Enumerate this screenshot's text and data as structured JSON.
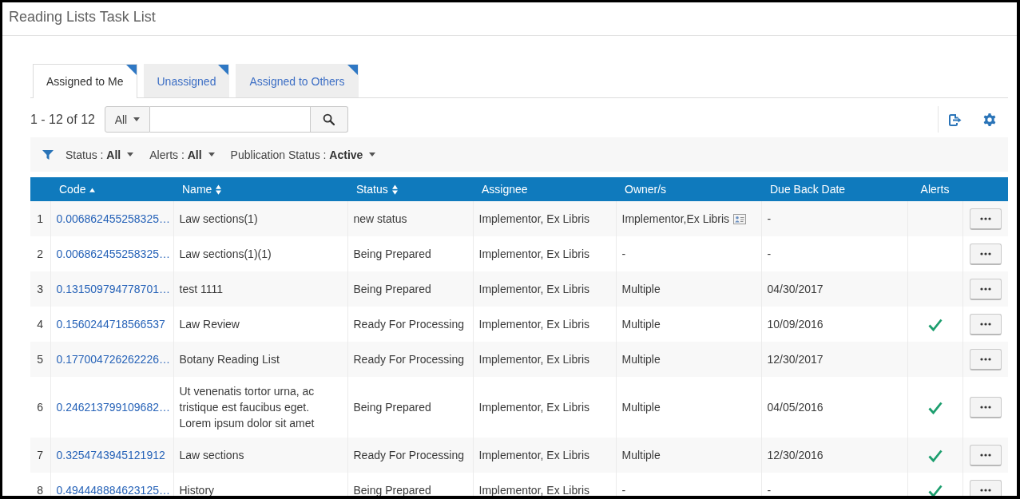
{
  "page": {
    "title": "Reading Lists Task List"
  },
  "tabs": [
    {
      "label": "Assigned to Me",
      "selected": true
    },
    {
      "label": "Unassigned",
      "selected": false
    },
    {
      "label": "Assigned to Others",
      "selected": false
    }
  ],
  "toolbar": {
    "count": "1 - 12 of 12",
    "scope": "All"
  },
  "filters": [
    {
      "text": "Status : **All**"
    },
    {
      "text": "Alerts : **All**"
    },
    {
      "text": "Publication Status : **Active**"
    }
  ],
  "table": {
    "columns": [
      {
        "label": "Code",
        "sortable": true,
        "sorted": true
      },
      {
        "label": "Name",
        "sortable": true,
        "sorted": false
      },
      {
        "label": "Status",
        "sortable": true,
        "sorted": false
      },
      {
        "label": "Assignee",
        "sortable": false,
        "sorted": false
      },
      {
        "label": "Owner/s",
        "sortable": false,
        "sorted": false
      },
      {
        "label": "Due Back Date",
        "sortable": false,
        "sorted": false
      },
      {
        "label": "Alerts",
        "sortable": false,
        "sorted": false
      }
    ],
    "rows": [
      {
        "number": "1",
        "code": "0.006862455258325…",
        "name": "Law sections(1)",
        "status": "new status",
        "assignee": "Implementor, Ex Libris",
        "owner": "Implementor,Ex Libris",
        "owner_card": true,
        "due": "-",
        "alert": false
      },
      {
        "number": "2",
        "code": "0.006862455258325…",
        "name": "Law sections(1)(1)",
        "status": "Being Prepared",
        "assignee": "Implementor, Ex Libris",
        "owner": "-",
        "owner_card": false,
        "due": "-",
        "alert": false
      },
      {
        "number": "3",
        "code": "0.131509794778701…",
        "name": "test 1111",
        "status": "Being Prepared",
        "assignee": "Implementor, Ex Libris",
        "owner": "Multiple",
        "owner_card": false,
        "due": "04/30/2017",
        "alert": false
      },
      {
        "number": "4",
        "code": "0.1560244718566537",
        "name": "Law Review",
        "status": "Ready For Processing",
        "assignee": "Implementor, Ex Libris",
        "owner": "Multiple",
        "owner_card": false,
        "due": "10/09/2016",
        "alert": true
      },
      {
        "number": "5",
        "code": "0.177004726262226…",
        "name": "Botany Reading List",
        "status": "Ready For Processing",
        "assignee": "Implementor, Ex Libris",
        "owner": "Multiple",
        "owner_card": false,
        "due": "12/30/2017",
        "alert": false
      },
      {
        "number": "6",
        "code": "0.246213799109682…",
        "name": "Ut venenatis tortor urna, ac tristique est faucibus eget. Lorem ipsum dolor sit amet",
        "status": "Being Prepared",
        "assignee": "Implementor, Ex Libris",
        "owner": "Multiple",
        "owner_card": false,
        "due": "04/05/2016",
        "alert": true
      },
      {
        "number": "7",
        "code": "0.3254743945121912",
        "name": "Law sections",
        "status": "Ready For Processing",
        "assignee": "Implementor, Ex Libris",
        "owner": "Multiple",
        "owner_card": false,
        "due": "12/30/2016",
        "alert": true
      },
      {
        "number": "8",
        "code": "0.494448884623125…",
        "name": "History",
        "status": "Being Prepared",
        "assignee": "Implementor, Ex Libris",
        "owner": "-",
        "owner_card": false,
        "due": "-",
        "alert": true
      }
    ]
  }
}
